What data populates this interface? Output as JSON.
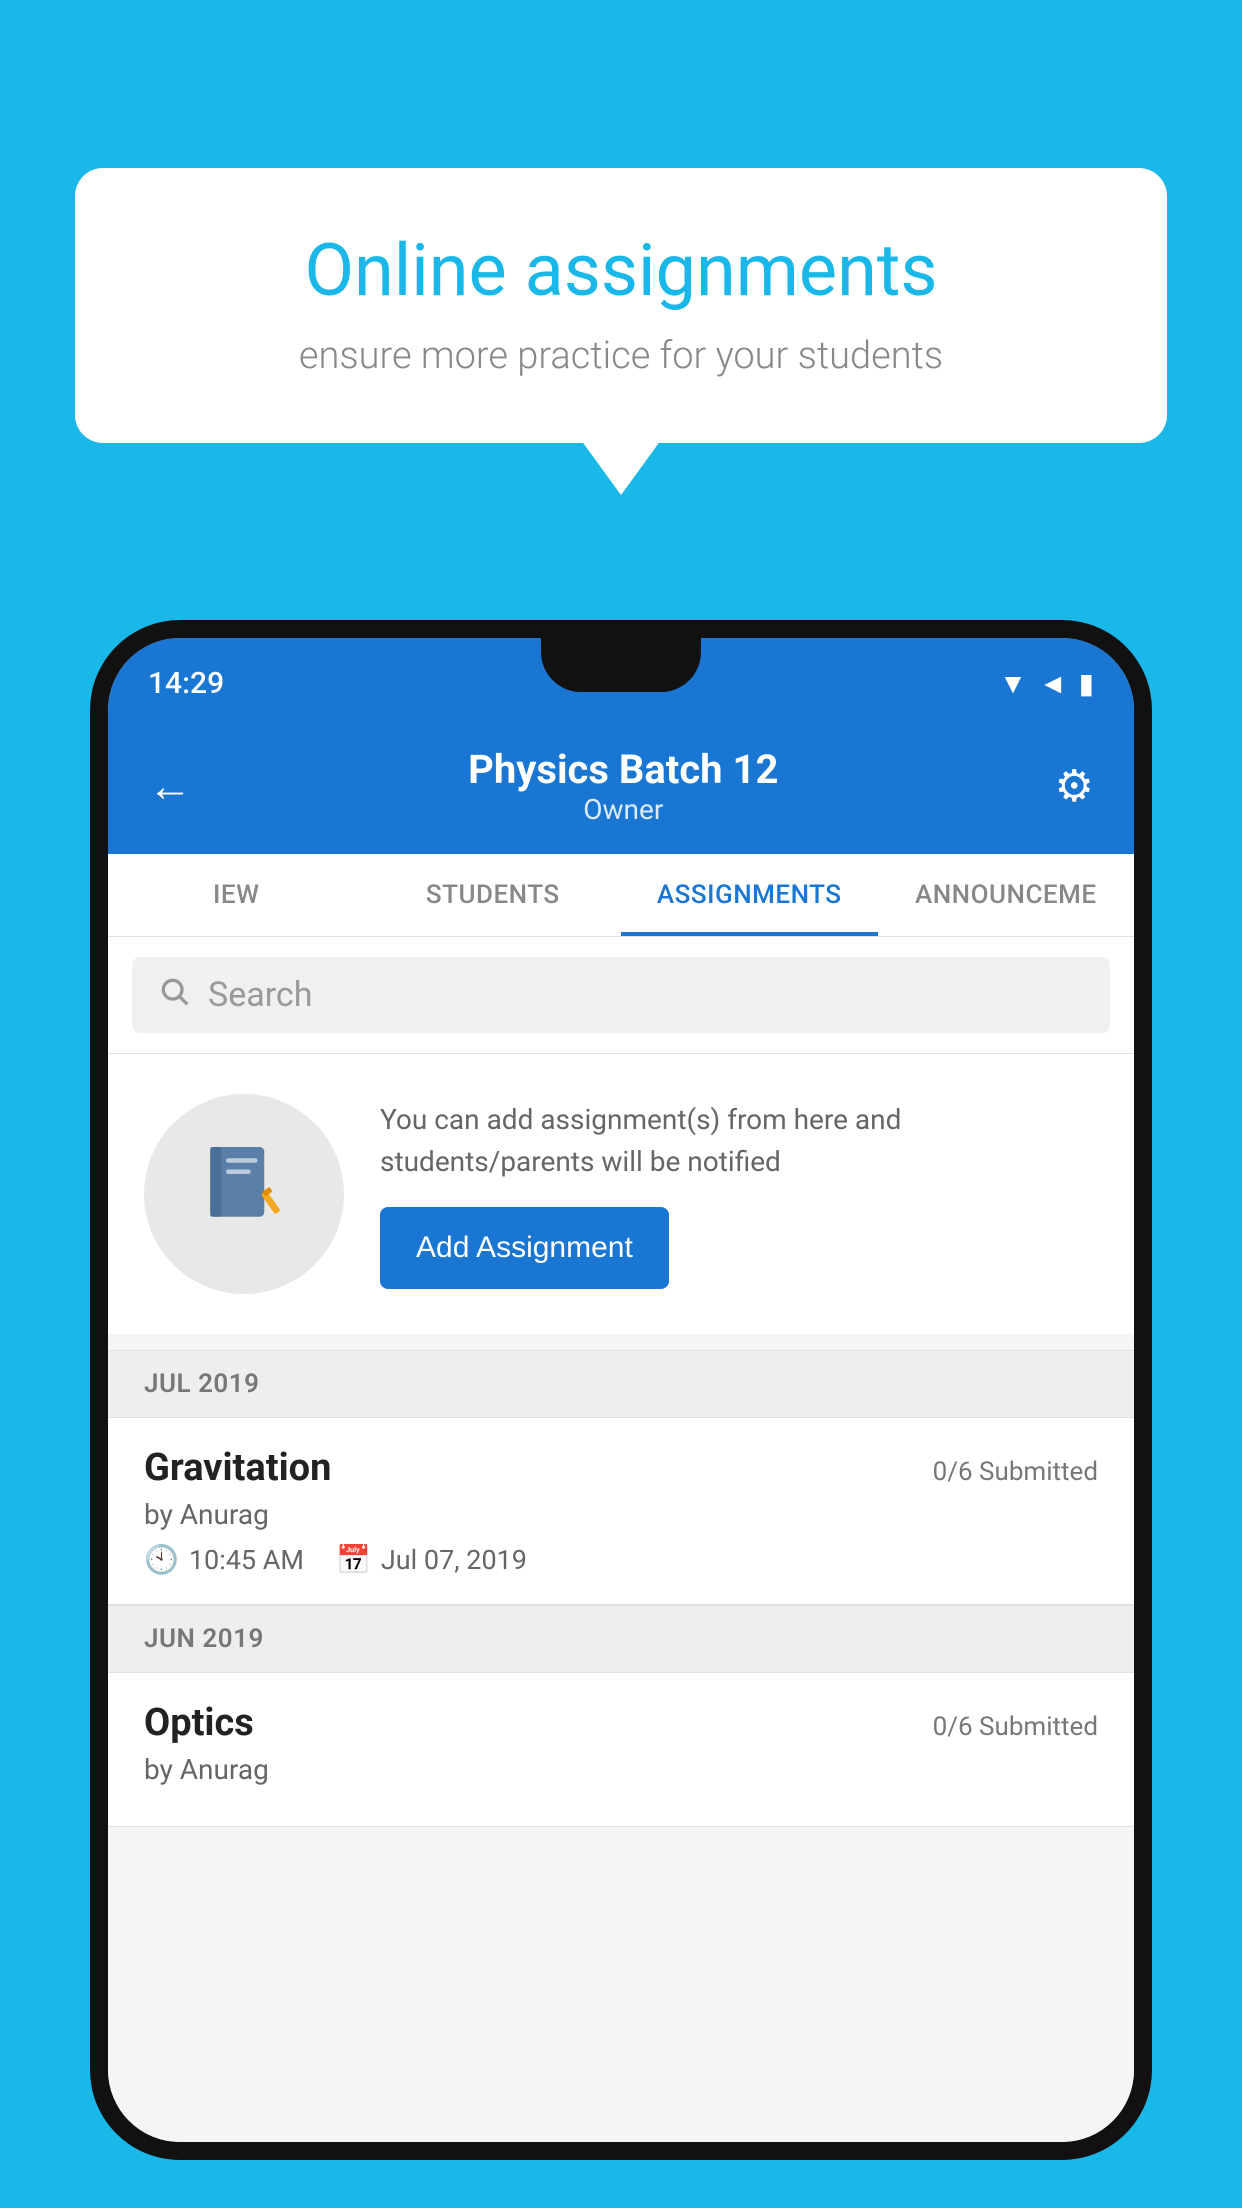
{
  "background_color": "#1ab8e8",
  "speech_bubble": {
    "title": "Online assignments",
    "subtitle": "ensure more practice for your students"
  },
  "status_bar": {
    "time": "14:29",
    "wifi_icon": "wifi",
    "signal_icon": "signal",
    "battery_icon": "battery"
  },
  "header": {
    "title": "Physics Batch 12",
    "subtitle": "Owner",
    "back_label": "←",
    "settings_label": "⚙"
  },
  "tabs": [
    {
      "label": "IEW",
      "active": false
    },
    {
      "label": "STUDENTS",
      "active": false
    },
    {
      "label": "ASSIGNMENTS",
      "active": true
    },
    {
      "label": "ANNOUNCEMENTS",
      "active": false
    }
  ],
  "search": {
    "placeholder": "Search"
  },
  "promo": {
    "text": "You can add assignment(s) from here and students/parents will be notified",
    "button_label": "Add Assignment",
    "icon": "📓"
  },
  "sections": [
    {
      "header": "JUL 2019",
      "assignments": [
        {
          "title": "Gravitation",
          "submitted": "0/6 Submitted",
          "author": "by Anurag",
          "time": "10:45 AM",
          "date": "Jul 07, 2019"
        }
      ]
    },
    {
      "header": "JUN 2019",
      "assignments": [
        {
          "title": "Optics",
          "submitted": "0/6 Submitted",
          "author": "by Anurag",
          "time": "",
          "date": ""
        }
      ]
    }
  ]
}
